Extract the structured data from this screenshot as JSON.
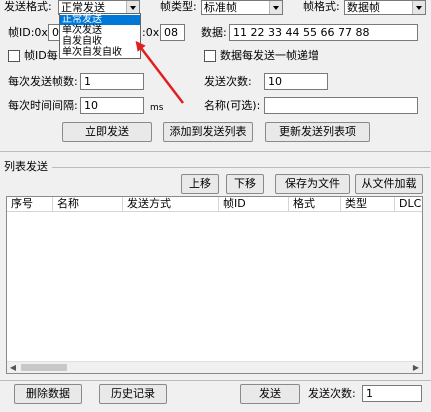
{
  "top": {
    "send_format_label": "发送格式:",
    "send_format_value": "正常发送",
    "frame_type_label": "帧类型:",
    "frame_type_value": "标准帧",
    "frame_format_label": "帧格式:",
    "frame_format_value": "数据帧"
  },
  "dropdown": {
    "options": [
      "正常发送",
      "单次发送",
      "自发自收",
      "单次自发自收"
    ]
  },
  "frame_id": {
    "label": "帧ID:0x",
    "value": "00",
    "extra_label": ":0x",
    "extra_value": "08"
  },
  "data": {
    "label": "数据:",
    "value": "11 22 33 44 55 66 77 88"
  },
  "options": {
    "frame_id_increment": "帧ID每",
    "data_increment": "数据每发送一帧递增"
  },
  "send_frames": {
    "label": "每次发送帧数:",
    "value": "1"
  },
  "send_count": {
    "label": "发送次数:",
    "value": "10"
  },
  "interval": {
    "label": "每次时间间隔:",
    "value": "10",
    "unit": "ms"
  },
  "name": {
    "label": "名称(可选):",
    "value": ""
  },
  "buttons": {
    "send_now": "立即发送",
    "add_to_list": "添加到发送列表",
    "update_list": "更新发送列表项"
  },
  "list_section": {
    "title": "列表发送",
    "move_up": "上移",
    "move_down": "下移",
    "save_file": "保存为文件",
    "load_file": "从文件加载",
    "columns": [
      "序号",
      "名称",
      "发送方式",
      "帧ID",
      "格式",
      "类型",
      "DLC"
    ]
  },
  "bottom": {
    "delete_data": "删除数据",
    "history": "历史记录",
    "send": "发送",
    "send_count_label": "发送次数:",
    "send_count_value": "1"
  },
  "colors": {
    "selection": "#0078d7",
    "arrow": "#e02020"
  }
}
